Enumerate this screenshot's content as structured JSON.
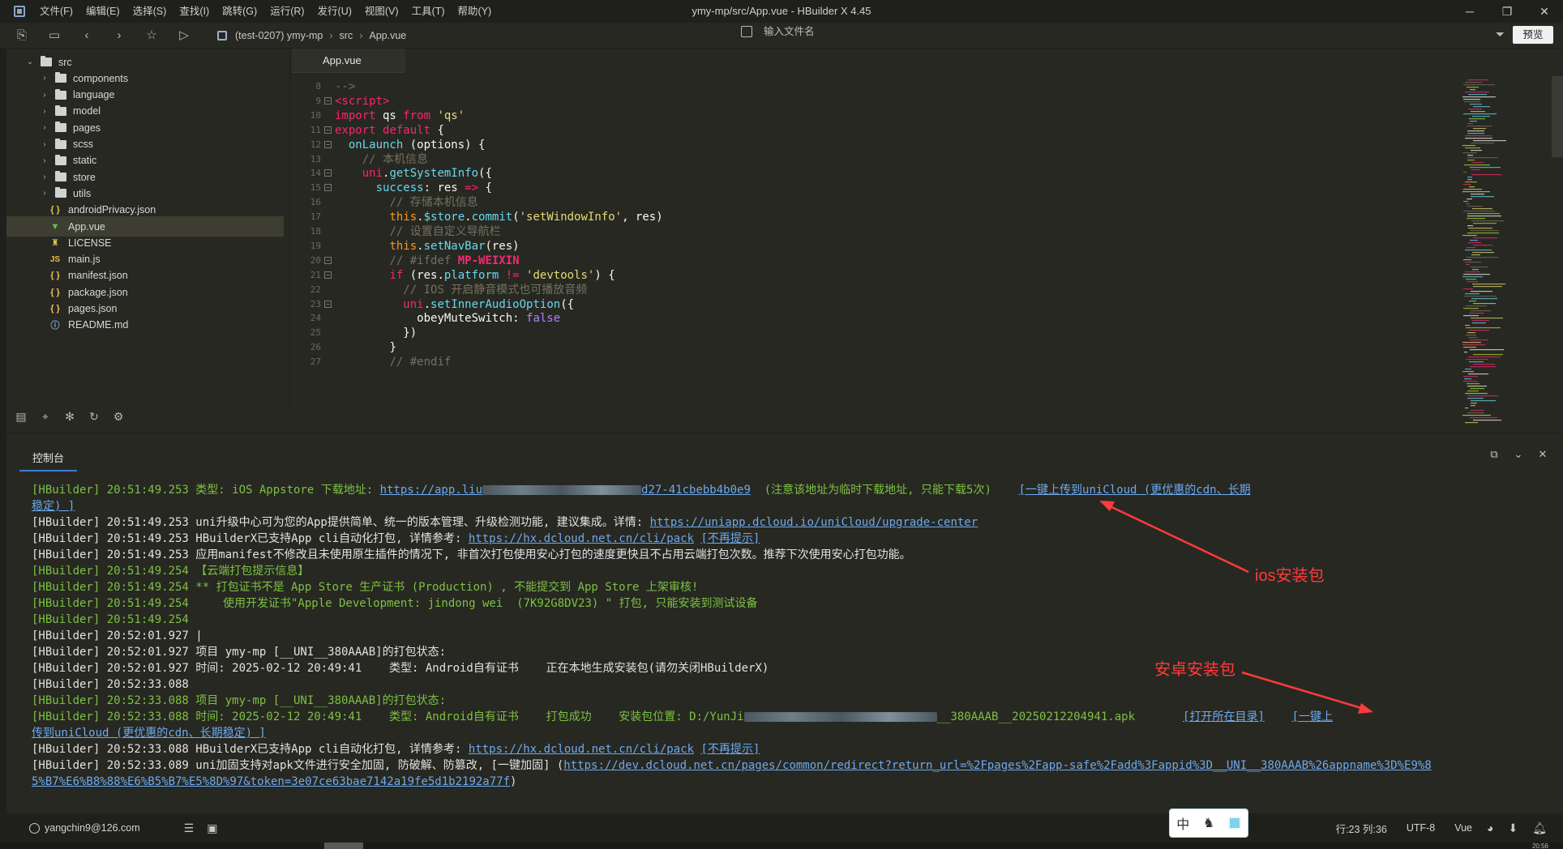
{
  "window": {
    "title": "ymy-mp/src/App.vue - HBuilder X 4.45",
    "menu": [
      "文件(F)",
      "编辑(E)",
      "选择(S)",
      "查找(I)",
      "跳转(G)",
      "运行(R)",
      "发行(U)",
      "视图(V)",
      "工具(T)",
      "帮助(Y)"
    ],
    "controls": {
      "minimize": "─",
      "restore": "❐",
      "close": "✕"
    }
  },
  "toolbar": {
    "breadcrumb": [
      "(test-0207) ymy-mp",
      "src",
      "App.vue"
    ],
    "file_search_placeholder": "输入文件名",
    "preview_label": "预览"
  },
  "sidebar": {
    "tree": [
      {
        "label": "src",
        "kind": "folder",
        "expanded": true,
        "depth": 0
      },
      {
        "label": "components",
        "kind": "folder",
        "depth": 1
      },
      {
        "label": "language",
        "kind": "folder",
        "depth": 1
      },
      {
        "label": "model",
        "kind": "folder",
        "depth": 1
      },
      {
        "label": "pages",
        "kind": "folder",
        "depth": 1
      },
      {
        "label": "scss",
        "kind": "folder",
        "depth": 1
      },
      {
        "label": "static",
        "kind": "folder",
        "depth": 1
      },
      {
        "label": "store",
        "kind": "folder",
        "depth": 1
      },
      {
        "label": "utils",
        "kind": "folder",
        "depth": 1
      },
      {
        "label": "androidPrivacy.json",
        "kind": "json",
        "depth": 1
      },
      {
        "label": "App.vue",
        "kind": "vue",
        "depth": 1,
        "selected": true
      },
      {
        "label": "LICENSE",
        "kind": "license",
        "depth": 1
      },
      {
        "label": "main.js",
        "kind": "js",
        "depth": 1
      },
      {
        "label": "manifest.json",
        "kind": "json",
        "depth": 1
      },
      {
        "label": "package.json",
        "kind": "json",
        "depth": 1
      },
      {
        "label": "pages.json",
        "kind": "json",
        "depth": 1
      },
      {
        "label": "README.md",
        "kind": "md",
        "depth": 1
      }
    ]
  },
  "editor": {
    "tab": "App.vue",
    "lines": [
      {
        "n": "8",
        "fold": false,
        "indent": "",
        "tokens": [
          [
            "c",
            "-->"
          ]
        ]
      },
      {
        "n": "9",
        "fold": true,
        "indent": "",
        "tokens": [
          [
            "k",
            "<script"
          ],
          [
            "k",
            ">"
          ]
        ]
      },
      {
        "n": "10",
        "fold": false,
        "indent": "",
        "tokens": [
          [
            "k",
            "import"
          ],
          [
            "w",
            " qs "
          ],
          [
            "k",
            "from"
          ],
          [
            "w",
            " "
          ],
          [
            "s",
            "'qs'"
          ]
        ]
      },
      {
        "n": "11",
        "fold": true,
        "indent": "",
        "tokens": [
          [
            "k",
            "export"
          ],
          [
            "w",
            " "
          ],
          [
            "k",
            "default"
          ],
          [
            "w",
            " {"
          ]
        ]
      },
      {
        "n": "12",
        "fold": true,
        "indent": "  ",
        "tokens": [
          [
            "f",
            "onLaunch"
          ],
          [
            "w",
            " (options) {"
          ]
        ]
      },
      {
        "n": "13",
        "fold": false,
        "indent": "    ",
        "tokens": [
          [
            "c",
            "// 本机信息"
          ]
        ]
      },
      {
        "n": "14",
        "fold": true,
        "indent": "    ",
        "tokens": [
          [
            "k",
            "uni"
          ],
          [
            "w",
            "."
          ],
          [
            "f",
            "getSystemInfo"
          ],
          [
            "w",
            "({"
          ]
        ]
      },
      {
        "n": "15",
        "fold": true,
        "indent": "      ",
        "tokens": [
          [
            "f",
            "success"
          ],
          [
            "w",
            ": res "
          ],
          [
            "k",
            "=>"
          ],
          [
            "w",
            " {"
          ]
        ]
      },
      {
        "n": "16",
        "fold": false,
        "indent": "        ",
        "tokens": [
          [
            "c",
            "// 存储本机信息"
          ]
        ]
      },
      {
        "n": "17",
        "fold": false,
        "indent": "        ",
        "tokens": [
          [
            "p",
            "this"
          ],
          [
            "w",
            "."
          ],
          [
            "f",
            "$store"
          ],
          [
            "w",
            "."
          ],
          [
            "f",
            "commit"
          ],
          [
            "w",
            "("
          ],
          [
            "s",
            "'setWindowInfo'"
          ],
          [
            "w",
            ", res)"
          ]
        ]
      },
      {
        "n": "18",
        "fold": false,
        "indent": "        ",
        "tokens": [
          [
            "c",
            "// 设置自定义导航栏"
          ]
        ]
      },
      {
        "n": "19",
        "fold": false,
        "indent": "        ",
        "tokens": [
          [
            "p",
            "this"
          ],
          [
            "w",
            "."
          ],
          [
            "f",
            "setNavBar"
          ],
          [
            "w",
            "(res)"
          ]
        ]
      },
      {
        "n": "20",
        "fold": true,
        "indent": "        ",
        "tokens": [
          [
            "c",
            "// #ifdef "
          ],
          [
            "r",
            "MP-WEIXIN"
          ]
        ]
      },
      {
        "n": "21",
        "fold": true,
        "indent": "        ",
        "tokens": [
          [
            "k",
            "if"
          ],
          [
            "w",
            " (res."
          ],
          [
            "f",
            "platform"
          ],
          [
            "w",
            " "
          ],
          [
            "k",
            "!="
          ],
          [
            "w",
            " "
          ],
          [
            "s",
            "'devtools'"
          ],
          [
            "w",
            ") {"
          ]
        ]
      },
      {
        "n": "22",
        "fold": false,
        "indent": "          ",
        "tokens": [
          [
            "c",
            "// IOS 开启静音模式也可播放音频"
          ]
        ]
      },
      {
        "n": "23",
        "fold": true,
        "indent": "          ",
        "tokens": [
          [
            "k",
            "uni"
          ],
          [
            "w",
            "."
          ],
          [
            "f",
            "setInnerAudioOption"
          ],
          [
            "w",
            "({"
          ]
        ]
      },
      {
        "n": "24",
        "fold": false,
        "indent": "            ",
        "tokens": [
          [
            "w",
            "obeyMuteSwitch: "
          ],
          [
            "v",
            "false"
          ]
        ]
      },
      {
        "n": "25",
        "fold": false,
        "indent": "          ",
        "tokens": [
          [
            "w",
            "})"
          ]
        ]
      },
      {
        "n": "26",
        "fold": false,
        "indent": "        ",
        "tokens": [
          [
            "w",
            "}"
          ]
        ]
      },
      {
        "n": "27",
        "fold": false,
        "indent": "        ",
        "tokens": [
          [
            "c",
            "// #endif"
          ]
        ]
      }
    ]
  },
  "console": {
    "tab": "控制台",
    "lines": [
      {
        "color": "green",
        "parts": [
          [
            "t",
            "[HBuilder] 20:51:49.253 类型: iOS Appstore 下载地址: "
          ],
          [
            "a",
            "https://app.liu"
          ],
          [
            "b",
            "196"
          ],
          [
            "a",
            "d27-41cbebb4b0e9"
          ],
          [
            "t",
            "  (注意该地址为临时下载地址, 只能下载5次)    "
          ],
          [
            "a",
            "[一键上传到uniCloud (更优惠的cdn、长期"
          ]
        ]
      },
      {
        "color": "green",
        "parts": [
          [
            "a",
            "稳定) ]"
          ]
        ]
      },
      {
        "color": "white",
        "parts": [
          [
            "t",
            "[HBuilder] 20:51:49.253 uni升级中心可为您的App提供简单、统一的版本管理、升级检测功能, 建议集成。详情: "
          ],
          [
            "a",
            "https://uniapp.dcloud.io/uniCloud/upgrade-center"
          ]
        ]
      },
      {
        "color": "white",
        "parts": [
          [
            "t",
            "[HBuilder] 20:51:49.253 HBuilderX已支持App cli自动化打包, 详情参考: "
          ],
          [
            "a",
            "https://hx.dcloud.net.cn/cli/pack"
          ],
          [
            "t",
            " "
          ],
          [
            "a",
            "[不再提示]"
          ]
        ]
      },
      {
        "color": "white",
        "parts": [
          [
            "t",
            "[HBuilder] 20:51:49.253 应用manifest不修改且未使用原生插件的情况下, 非首次打包使用安心打包的速度更快且不占用云端打包次数。推荐下次使用安心打包功能。"
          ]
        ]
      },
      {
        "color": "green",
        "parts": [
          [
            "t",
            "[HBuilder] 20:51:49.254 【云端打包提示信息】"
          ]
        ]
      },
      {
        "color": "green",
        "parts": [
          [
            "t",
            "[HBuilder] 20:51:49.254 ** 打包证书不是 App Store 生产证书 (Production) , 不能提交到 App Store 上架审核!"
          ]
        ]
      },
      {
        "color": "green",
        "parts": [
          [
            "t",
            "[HBuilder] 20:51:49.254     使用开发证书\"Apple Development: jindong wei  (7K92G8DV23) \" 打包, 只能安装到测试设备"
          ]
        ]
      },
      {
        "color": "green",
        "parts": [
          [
            "t",
            "[HBuilder] 20:51:49.254"
          ]
        ]
      },
      {
        "color": "white",
        "parts": [
          [
            "t",
            "[HBuilder] 20:52:01.927 |"
          ]
        ]
      },
      {
        "color": "white",
        "parts": [
          [
            "t",
            "[HBuilder] 20:52:01.927 项目 ymy-mp [__UNI__380AAAB]的打包状态:"
          ]
        ]
      },
      {
        "color": "white",
        "parts": [
          [
            "t",
            "[HBuilder] 20:52:01.927 时间: 2025-02-12 20:49:41    类型: Android自有证书    正在本地生成安装包(请勿关闭HBuilderX)"
          ]
        ]
      },
      {
        "color": "white",
        "parts": [
          [
            "t",
            "[HBuilder] 20:52:33.088"
          ]
        ]
      },
      {
        "color": "green",
        "parts": [
          [
            "t",
            "[HBuilder] 20:52:33.088 项目 ymy-mp [__UNI__380AAAB]的打包状态:"
          ]
        ]
      },
      {
        "color": "green",
        "parts": [
          [
            "t",
            "[HBuilder] 20:52:33.088 时间: 2025-02-12 20:49:41    类型: Android自有证书    打包成功    安装包位置: D:/YunJi"
          ],
          [
            "b",
            "238"
          ],
          [
            "t",
            "__380AAAB__20250212204941.apk       "
          ],
          [
            "a",
            "[打开所在目录]"
          ],
          [
            "t",
            "    "
          ],
          [
            "a",
            "[一键上"
          ]
        ]
      },
      {
        "color": "green",
        "parts": [
          [
            "a",
            "传到uniCloud (更优惠的cdn、长期稳定) ]"
          ]
        ]
      },
      {
        "color": "white",
        "parts": [
          [
            "t",
            "[HBuilder] 20:52:33.088 HBuilderX已支持App cli自动化打包, 详情参考: "
          ],
          [
            "a",
            "https://hx.dcloud.net.cn/cli/pack"
          ],
          [
            "t",
            " "
          ],
          [
            "a",
            "[不再提示]"
          ]
        ]
      },
      {
        "color": "white",
        "parts": [
          [
            "t",
            "[HBuilder] 20:52:33.089 uni加固支持对apk文件进行安全加固, 防破解、防篡改, [一键加固] ("
          ],
          [
            "a",
            "https://dev.dcloud.net.cn/pages/common/redirect?return_url=%2Fpages%2Fapp-safe%2Fadd%3Fappid%3D__UNI__380AAAB%26appname%3D%E9%8"
          ]
        ]
      },
      {
        "color": "white",
        "parts": [
          [
            "a",
            "5%B7%E6%B8%88%E6%B5%B7%E5%8D%97&token=3e07ce63bae7142a19fe5d1b2192a77f"
          ],
          [
            "t",
            ")"
          ]
        ]
      }
    ]
  },
  "annotations": {
    "ios_label": "ios安装包",
    "android_label": "安卓安装包",
    "color": "#ff3b3b"
  },
  "statusbar": {
    "user": "yangchin9@126.com",
    "ime_lang": "中",
    "position": "行:23  列:36",
    "encoding": "UTF-8",
    "language": "Vue",
    "clock": "20:56"
  },
  "colors": {
    "editor_bg": "#272822",
    "green_log": "#7dc142",
    "link": "#6da9ee",
    "accent": "#3f7bd6"
  }
}
